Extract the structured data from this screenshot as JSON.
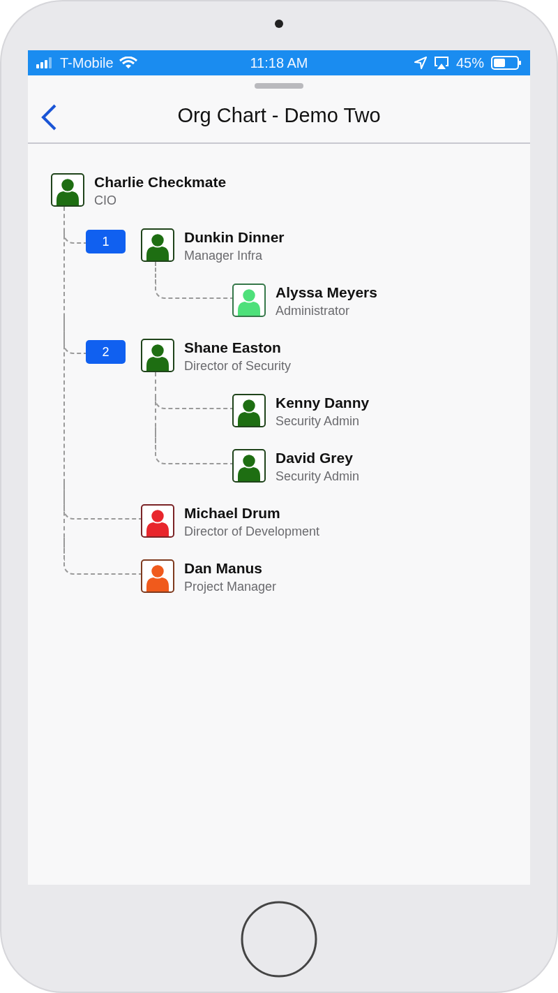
{
  "status_bar": {
    "carrier": "T-Mobile",
    "time": "11:18 AM",
    "battery": "45%"
  },
  "header": {
    "title": "Org Chart - Demo Two"
  },
  "org_chart": {
    "root": {
      "name": "Charlie Checkmate",
      "title": "CIO",
      "color": "#1e6e12",
      "children": [
        {
          "name": "Dunkin Dinner",
          "title": "Manager Infra",
          "color": "#1e6e12",
          "badge": "1",
          "children": [
            {
              "name": "Alyssa Meyers",
              "title": "Administrator",
              "color": "#4ee07a"
            }
          ]
        },
        {
          "name": "Shane Easton",
          "title": "Director of Security",
          "color": "#1e6e12",
          "badge": "2",
          "children": [
            {
              "name": "Kenny Danny",
              "title": "Security Admin",
              "color": "#1e6e12"
            },
            {
              "name": "David Grey",
              "title": "Security Admin",
              "color": "#1e6e12"
            }
          ]
        },
        {
          "name": "Michael Drum",
          "title": "Director of Development",
          "color": "#e8262c"
        },
        {
          "name": "Dan Manus",
          "title": "Project Manager",
          "color": "#f05a1c"
        }
      ]
    }
  }
}
